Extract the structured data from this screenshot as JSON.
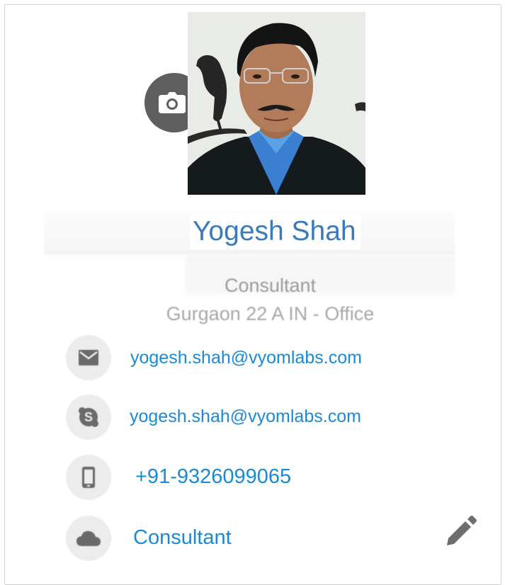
{
  "profile": {
    "name": "Yogesh Shah",
    "title": "Consultant",
    "location": "Gurgaon 22 A IN - Office",
    "photo_alt": "Yogesh Shah"
  },
  "contacts": {
    "email": "yogesh.shah@vyomlabs.com",
    "skype": "yogesh.shah@vyomlabs.com",
    "phone": "+91-9326099065",
    "department": "Consultant"
  },
  "icons": {
    "camera": "camera-icon",
    "email": "mail-icon",
    "skype": "skype-icon",
    "phone": "mobile-phone-icon",
    "department": "cloud-icon",
    "edit": "pencil-icon"
  },
  "colors": {
    "name": "#3a7ab8",
    "link": "#1a8ad6",
    "muted_text": "#9b9b9b",
    "icon_circle": "#ececec",
    "camera_circle": "#5f5f5f"
  }
}
